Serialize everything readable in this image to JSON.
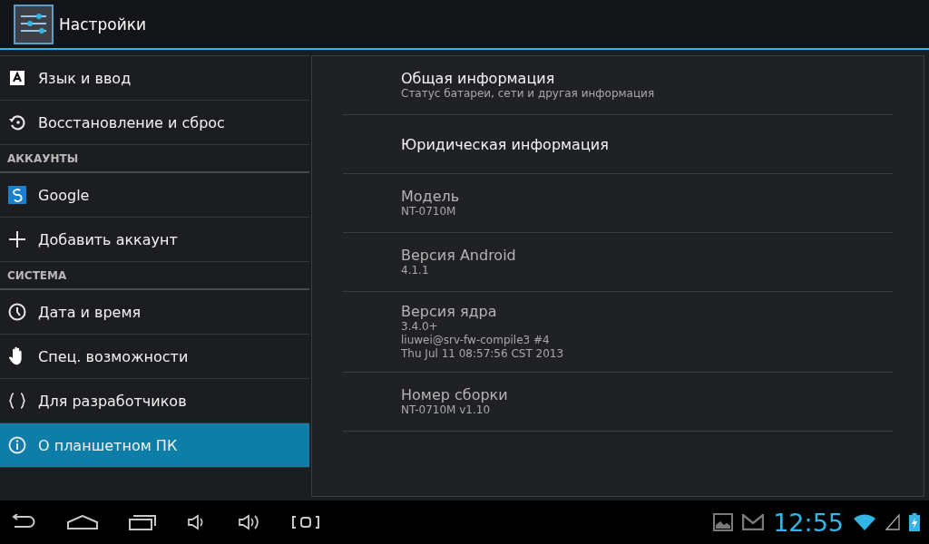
{
  "action_bar": {
    "title": "Настройки"
  },
  "sidebar": {
    "items": [
      {
        "kind": "item",
        "label": "Язык и ввод",
        "selected": false
      },
      {
        "kind": "item",
        "label": "Восстановление и сброс",
        "selected": false
      },
      {
        "kind": "header",
        "label": "АККАУНТЫ"
      },
      {
        "kind": "item",
        "label": "Google",
        "selected": false
      },
      {
        "kind": "item",
        "label": "Добавить аккаунт",
        "selected": false
      },
      {
        "kind": "header",
        "label": "СИСТЕМА"
      },
      {
        "kind": "item",
        "label": "Дата и время",
        "selected": false
      },
      {
        "kind": "item",
        "label": "Спец. возможности",
        "selected": false
      },
      {
        "kind": "item",
        "label": "Для разработчиков",
        "selected": false
      },
      {
        "kind": "item",
        "label": "О планшетном ПК",
        "selected": true
      }
    ]
  },
  "details": {
    "rows": [
      {
        "kind": "link",
        "title": "Общая информация",
        "summary": [
          "Статус батареи, сети и другая информация"
        ]
      },
      {
        "kind": "link",
        "title": "Юридическая информация"
      },
      {
        "kind": "info",
        "title": "Модель",
        "summary": [
          "NT-0710M"
        ]
      },
      {
        "kind": "info",
        "title": "Версия Android",
        "summary": [
          "4.1.1"
        ]
      },
      {
        "kind": "info",
        "title": "Версия ядра",
        "summary": [
          "3.4.0+",
          "liuwei@srv-fw-compile3 #4",
          "Thu Jul 11 08:57:56 CST 2013"
        ]
      },
      {
        "kind": "info",
        "title": "Номер сборки",
        "summary": [
          "NT-0710M v1.10"
        ]
      }
    ]
  },
  "system_bar": {
    "time": "12:55"
  }
}
